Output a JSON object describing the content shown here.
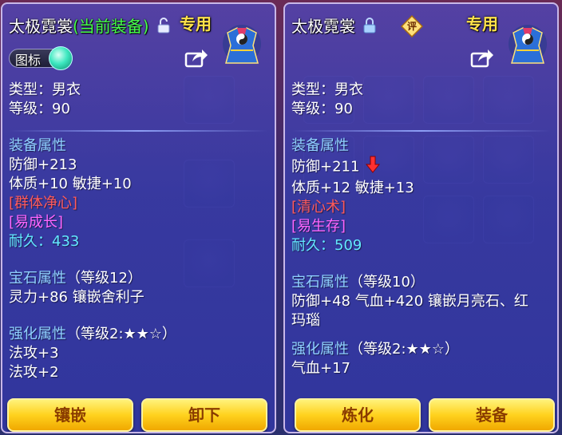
{
  "left_panel": {
    "item_name": "太极霓裳",
    "equip_status": "(当前装备)",
    "exclusive_label": "专用",
    "icon_toggle_label": "图标",
    "type_line": "类型：男衣",
    "level_line": "等级：90",
    "equip_attr_header": "装备属性",
    "defense": "防御+213",
    "stats": "体质+10 敏捷+10",
    "special_skill": "[群体净心]",
    "special_trait": "[易成长]",
    "durability_label": "耐久：",
    "durability_value": "433",
    "gem_header": "宝石属性",
    "gem_level": "（等级12）",
    "gem_line": "灵力+86 镶嵌舍利子",
    "refine_header": "强化属性",
    "refine_level": "（等级2:★★☆）",
    "refine_line1": "法攻+3",
    "refine_line2": "法攻+2",
    "button_left": "镶嵌",
    "button_right": "卸下"
  },
  "right_panel": {
    "item_name": "太极霓裳",
    "eval_badge": "评",
    "exclusive_label": "专用",
    "type_line": "类型：男衣",
    "level_line": "等级：90",
    "equip_attr_header": "装备属性",
    "defense": "防御+211",
    "stats": "体质+12 敏捷+13",
    "special_skill": "[清心术]",
    "special_trait": "[易生存]",
    "durability_label": "耐久：",
    "durability_value": "509",
    "gem_header": "宝石属性",
    "gem_level": "（等级10）",
    "gem_line1": "防御+48 气血+420 镶嵌月亮石、红",
    "gem_line2": "玛瑙",
    "refine_header": "强化属性",
    "refine_level": "（等级2:★★☆）",
    "refine_line1": "气血+17",
    "button_left": "炼化",
    "button_right": "装备"
  },
  "colors": {
    "equip_tag": "#46ff4a",
    "exclusive": "#ffe24a",
    "header": "#8fd0ff",
    "skill": "#ff5a5a",
    "trait": "#ff66ff",
    "durability": "#63e8ff",
    "button": "#ffd21e"
  },
  "icons": {
    "lock_open": "unlocked-padlock-icon",
    "lock_closed": "locked-padlock-icon",
    "share": "share-arrow-icon",
    "item": "robe-item-icon",
    "down_arrow": "red-down-arrow-icon"
  }
}
